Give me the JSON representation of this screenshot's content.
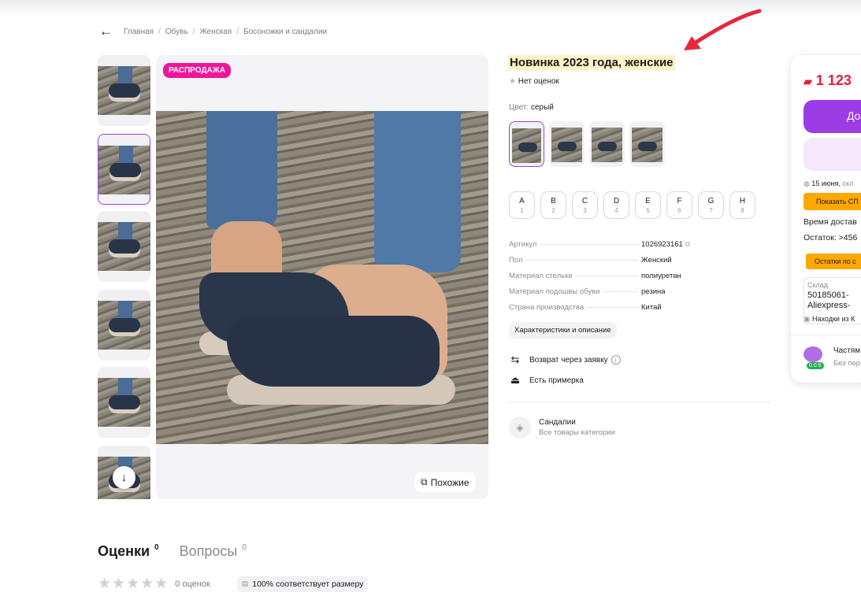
{
  "breadcrumbs": [
    "Главная",
    "Обувь",
    "Женская",
    "Босоножки и сандалии"
  ],
  "product": {
    "badge": "РАСПРОДАЖА",
    "title": "Новинка 2023 года, женские",
    "rating_text": "Нет оценок",
    "color_label": "Цвет:",
    "color_value": "серый",
    "sizes": [
      {
        "letter": "A",
        "num": "1"
      },
      {
        "letter": "B",
        "num": "2"
      },
      {
        "letter": "C",
        "num": "3"
      },
      {
        "letter": "D",
        "num": "4"
      },
      {
        "letter": "E",
        "num": "5"
      },
      {
        "letter": "F",
        "num": "6"
      },
      {
        "letter": "G",
        "num": "7"
      },
      {
        "letter": "H",
        "num": "8"
      }
    ],
    "specs": [
      {
        "k": "Артикул",
        "v": "1026923161"
      },
      {
        "k": "Пол",
        "v": "Женский"
      },
      {
        "k": "Материал стельки",
        "v": "полиуретан"
      },
      {
        "k": "Материал подошвы обуви",
        "v": "резина"
      },
      {
        "k": "Страна производства",
        "v": "Китай"
      }
    ],
    "desc_button": "Характеристики и описание",
    "return_text": "Возврат через заявку",
    "fitting_text": "Есть примерка",
    "category_name": "Сандалии",
    "category_sub": "Все товары категории",
    "similar_button": "Похожие"
  },
  "buybox": {
    "price": "1 123",
    "buy_label": "До",
    "delivery_date": "15 июня,",
    "delivery_suffix": "скл",
    "show_btn": "Показать СП",
    "delivery_time": "Время достав",
    "stock": "Остаток: >456",
    "stock_btn": "Остатки по с",
    "warehouse_label": "Склад",
    "warehouse_value": "50185061-Aliexpress-",
    "finds": "Находки из К",
    "seller_name": "Частям",
    "seller_sub": "Без пер",
    "seller_rating": "0.0 6"
  },
  "reviews": {
    "tab_reviews": "Оценки",
    "tab_reviews_count": "0",
    "tab_questions": "Вопросы",
    "tab_questions_count": "0",
    "count_text": "0 оценок",
    "fit_text": "100% соответствует размеру"
  },
  "colors": {
    "accent": "#9b3ce6",
    "badge": "#f0149b",
    "price": "#f01a3c",
    "highlight": "#fff1c7",
    "annotation_arrow": "#e8263c"
  }
}
